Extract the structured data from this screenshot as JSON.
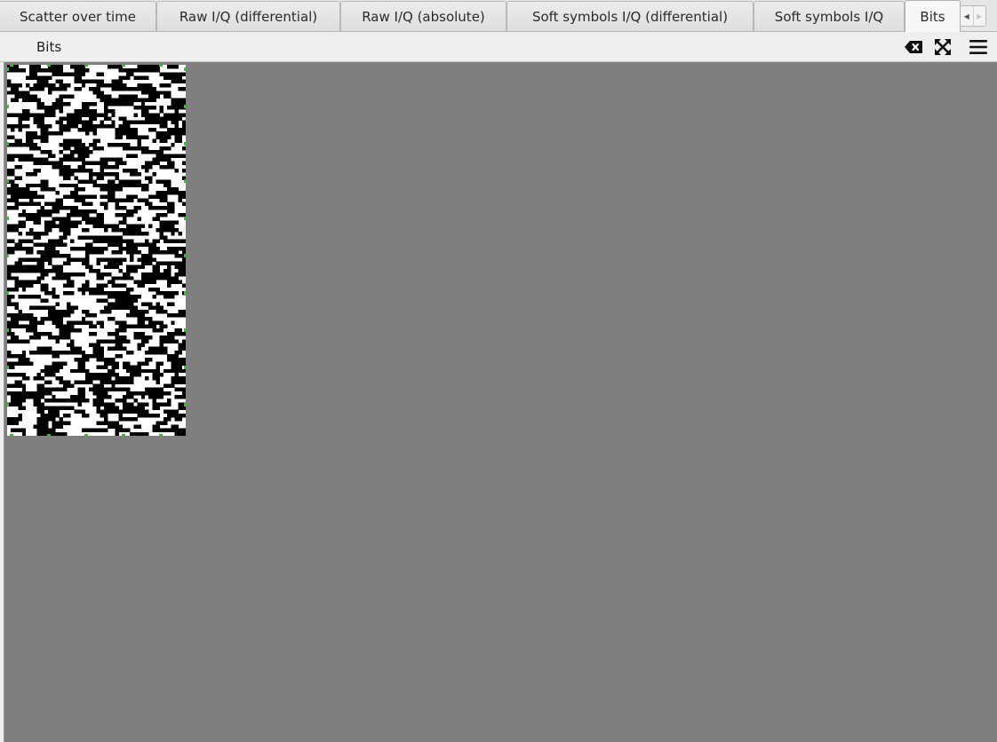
{
  "tabs": [
    {
      "label": "Scatter over time",
      "active": false
    },
    {
      "label": "Raw I/Q (differential)",
      "active": false
    },
    {
      "label": "Raw I/Q (absolute)",
      "active": false
    },
    {
      "label": "Soft symbols I/Q (differential)",
      "active": false
    },
    {
      "label": "Soft symbols I/Q",
      "active": false
    },
    {
      "label": "Bits",
      "active": true
    }
  ],
  "tab_scroll": {
    "left_icon": "scroll-left-arrow",
    "right_icon": "scroll-right-arrow"
  },
  "plot": {
    "title": "Bits",
    "toolbar": {
      "clear_icon": "clear-icon",
      "fullscreen_icon": "fullscreen-icon",
      "menu_icon": "hamburger-menu-icon"
    },
    "bits": {
      "columns": 48,
      "rows": 100,
      "one_color": "#000000",
      "zero_color": "#ffffff",
      "marker_color": "#22cc22"
    }
  },
  "colors": {
    "plot_background": "#7f7f7f",
    "tab_background": "#e6e6e6",
    "active_tab_background": "#f7f7f7"
  }
}
